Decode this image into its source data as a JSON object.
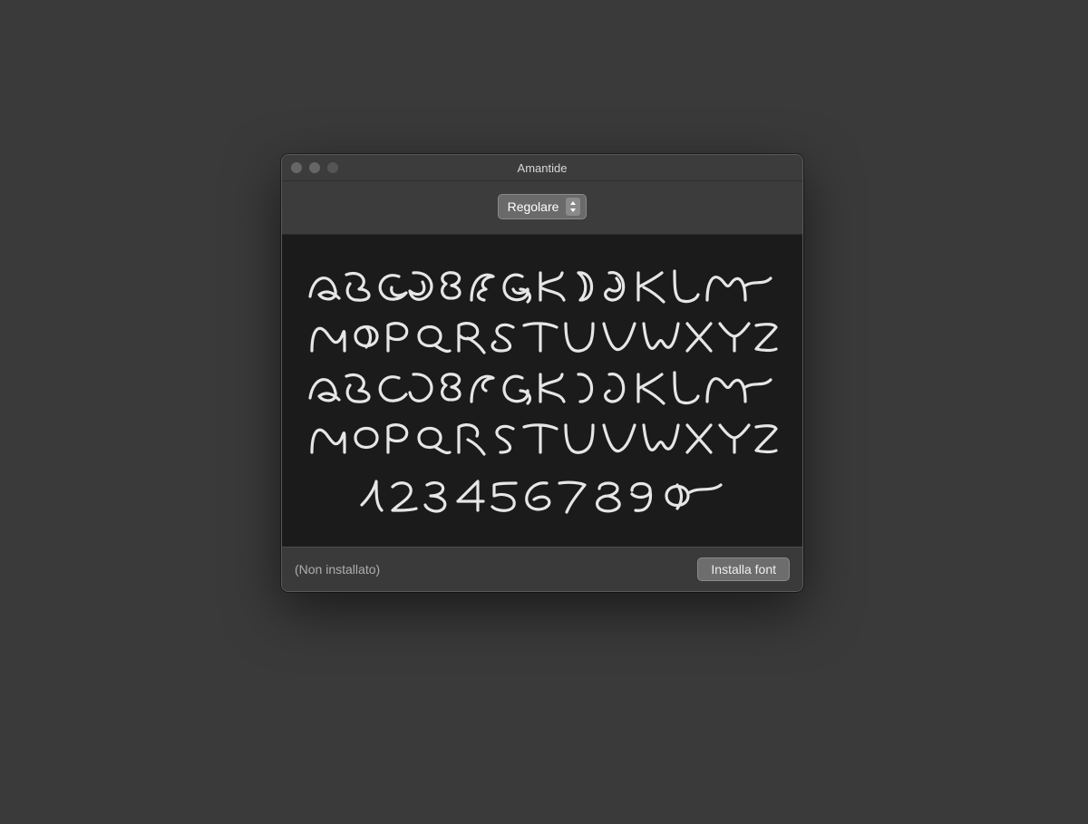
{
  "window": {
    "title": "Amantide"
  },
  "toolbar": {
    "style_selected": "Regolare"
  },
  "footer": {
    "status": "(Non installato)",
    "install_label": "Installa font"
  }
}
